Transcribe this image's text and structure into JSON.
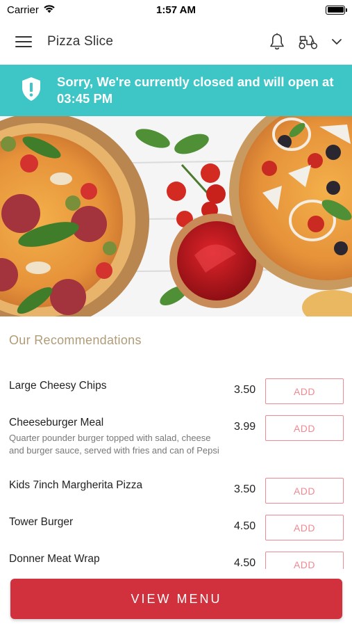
{
  "status_bar": {
    "carrier": "Carrier",
    "time": "1:57 AM",
    "wifi_icon": "wifi-icon",
    "battery_icon": "battery-icon"
  },
  "navbar": {
    "title": "Pizza Slice",
    "menu_icon": "hamburger-menu-icon",
    "notification_icon": "bell-icon",
    "delivery_icon": "scooter-icon",
    "dropdown_icon": "chevron-down-icon"
  },
  "banner": {
    "icon": "shield-alert-icon",
    "message": "Sorry, We're currently closed and will open at 03:45 PM",
    "background": "#3ec5c6"
  },
  "hero": {
    "image": "pizza-hero-image"
  },
  "recommendations": {
    "title": "Our Recommendations",
    "items": [
      {
        "name": "Large Cheesy Chips",
        "description": "",
        "price": "3.50",
        "button": "ADD"
      },
      {
        "name": "Cheeseburger Meal",
        "description": "Quarter pounder burger topped with salad, cheese and burger sauce, served with fries and can of Pepsi",
        "price": "3.99",
        "button": "ADD"
      },
      {
        "name": "Kids 7inch Margherita Pizza",
        "description": "",
        "price": "3.50",
        "button": "ADD"
      },
      {
        "name": "Tower Burger",
        "description": "",
        "price": "4.50",
        "button": "ADD"
      },
      {
        "name": "Donner Meat Wrap",
        "description": "",
        "price": "4.50",
        "button": "ADD"
      }
    ]
  },
  "footer": {
    "view_menu_label": "VIEW MENU",
    "button_color": "#d0313c"
  },
  "colors": {
    "accent_teal": "#3ec5c6",
    "add_button_pink": "#ef8a92",
    "section_title_gold": "#b19b77"
  }
}
